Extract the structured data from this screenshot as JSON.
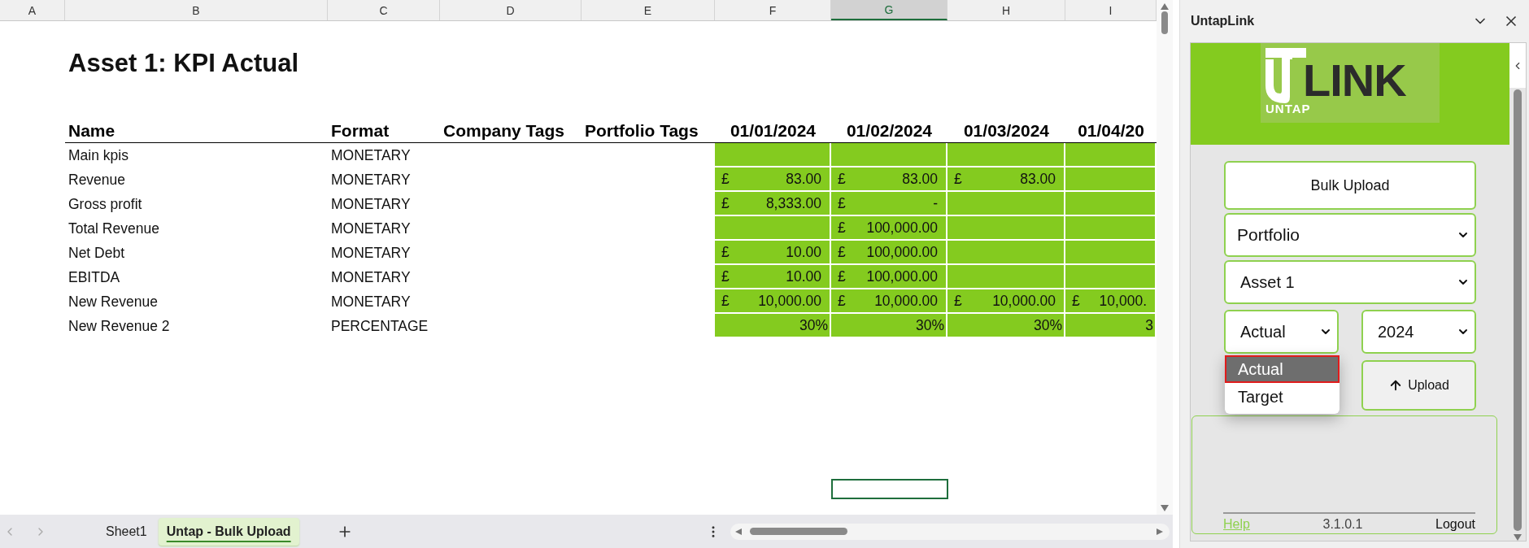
{
  "sheet": {
    "column_headers": [
      {
        "label": "A",
        "selected": false
      },
      {
        "label": "B",
        "selected": false
      },
      {
        "label": "C",
        "selected": false
      },
      {
        "label": "D",
        "selected": false
      },
      {
        "label": "E",
        "selected": false
      },
      {
        "label": "F",
        "selected": false
      },
      {
        "label": "G",
        "selected": true
      },
      {
        "label": "H",
        "selected": false
      },
      {
        "label": "I",
        "selected": false
      }
    ],
    "title": "Asset 1: KPI Actual",
    "table": {
      "columns": [
        "Name",
        "Format",
        "Company Tags",
        "Portfolio Tags",
        "01/01/2024",
        "01/02/2024",
        "01/03/2024",
        "01/04/20"
      ],
      "rows": [
        {
          "name": "Main kpis",
          "format": "MONETARY",
          "values": [
            {
              "kind": "empty"
            },
            {
              "kind": "empty"
            },
            {
              "kind": "empty"
            },
            {
              "kind": "empty"
            }
          ]
        },
        {
          "name": "Revenue",
          "format": "MONETARY",
          "values": [
            {
              "kind": "currency",
              "currency": "£",
              "amount": "83.00"
            },
            {
              "kind": "currency",
              "currency": "£",
              "amount": "83.00"
            },
            {
              "kind": "currency",
              "currency": "£",
              "amount": "83.00"
            },
            {
              "kind": "empty"
            }
          ]
        },
        {
          "name": "Gross profit",
          "format": "MONETARY",
          "values": [
            {
              "kind": "currency",
              "currency": "£",
              "amount": "8,333.00"
            },
            {
              "kind": "currency",
              "currency": "£",
              "amount": "-"
            },
            {
              "kind": "empty"
            },
            {
              "kind": "empty"
            }
          ]
        },
        {
          "name": "Total Revenue",
          "format": "MONETARY",
          "values": [
            {
              "kind": "empty"
            },
            {
              "kind": "currency",
              "currency": "£",
              "amount": "100,000.00"
            },
            {
              "kind": "empty"
            },
            {
              "kind": "empty"
            }
          ]
        },
        {
          "name": "Net Debt",
          "format": "MONETARY",
          "values": [
            {
              "kind": "currency",
              "currency": "£",
              "amount": "10.00"
            },
            {
              "kind": "currency",
              "currency": "£",
              "amount": "100,000.00"
            },
            {
              "kind": "empty"
            },
            {
              "kind": "empty"
            }
          ]
        },
        {
          "name": "EBITDA",
          "format": "MONETARY",
          "values": [
            {
              "kind": "currency",
              "currency": "£",
              "amount": "10.00"
            },
            {
              "kind": "currency",
              "currency": "£",
              "amount": "100,000.00"
            },
            {
              "kind": "empty"
            },
            {
              "kind": "empty"
            }
          ]
        },
        {
          "name": "New Revenue",
          "format": "MONETARY",
          "values": [
            {
              "kind": "currency",
              "currency": "£",
              "amount": "10,000.00"
            },
            {
              "kind": "currency",
              "currency": "£",
              "amount": "10,000.00"
            },
            {
              "kind": "currency",
              "currency": "£",
              "amount": "10,000.00"
            },
            {
              "kind": "currency",
              "currency": "£",
              "amount": "10,000."
            }
          ]
        },
        {
          "name": "New Revenue 2",
          "format": "PERCENTAGE",
          "values": [
            {
              "kind": "percent",
              "amount": "30%"
            },
            {
              "kind": "percent",
              "amount": "30%"
            },
            {
              "kind": "percent",
              "amount": "30%"
            },
            {
              "kind": "percent",
              "amount": "3"
            }
          ]
        }
      ]
    }
  },
  "sheet_tabs": [
    {
      "label": "Sheet1",
      "selected": false
    },
    {
      "label": "Untap - Bulk Upload",
      "selected": true
    }
  ],
  "panel": {
    "title": "UntapLink",
    "logo": {
      "wordmark": "LINK",
      "tagline": "UNTAP"
    },
    "bulk_upload_button": "Bulk Upload",
    "portfolio_select": {
      "value": "Portfolio"
    },
    "asset_select": {
      "value": "Asset 1"
    },
    "type_select": {
      "value": "Actual",
      "expanded": true,
      "options": [
        {
          "label": "Actual",
          "selected": true
        },
        {
          "label": "Target",
          "selected": false
        }
      ]
    },
    "year_select": {
      "value": "2024"
    },
    "upload_button": "Upload",
    "footer": {
      "help_link": "Help",
      "version": "3.1.0.1",
      "logout": "Logout"
    }
  }
}
